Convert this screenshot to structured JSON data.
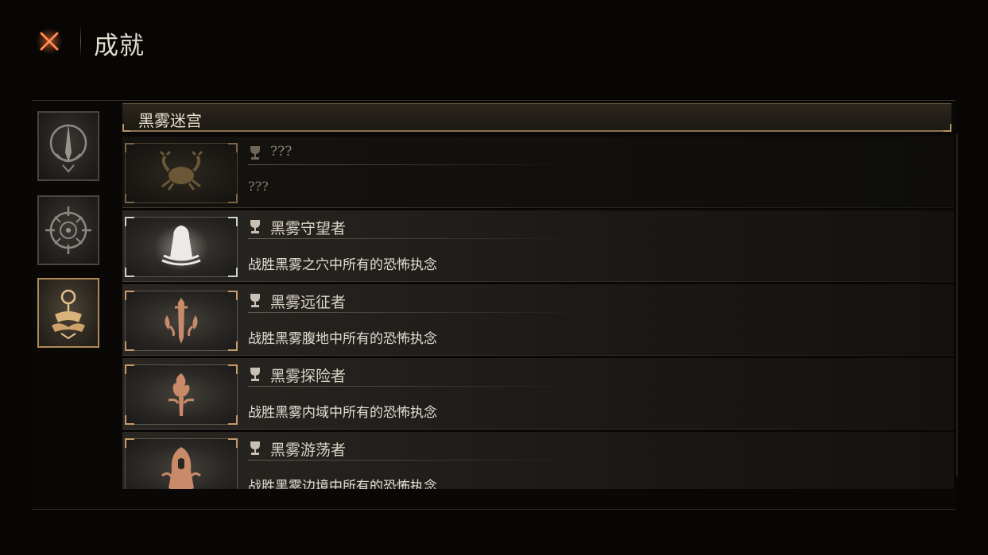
{
  "header": {
    "title": "成就",
    "close_icon": "close-x-icon",
    "accent_color": "#e0622c"
  },
  "categories": [
    {
      "icon": "lantern-spire-icon",
      "active": false
    },
    {
      "icon": "compass-wheel-icon",
      "active": false
    },
    {
      "icon": "ritual-figure-icon",
      "active": true
    }
  ],
  "section": {
    "title": "黑雾迷宫"
  },
  "achievements": [
    {
      "title": "???",
      "description": "???",
      "icon": "crab-emblem-icon",
      "unlocked": false
    },
    {
      "title": "黑雾守望者",
      "description": "战胜黑雾之穴中所有的恐怖执念",
      "icon": "hooded-ghost-icon",
      "unlocked": true
    },
    {
      "title": "黑雾远征者",
      "description": "战胜黑雾腹地中所有的恐怖执念",
      "icon": "sword-tendrils-icon",
      "unlocked": true
    },
    {
      "title": "黑雾探险者",
      "description": "战胜黑雾内域中所有的恐怖执念",
      "icon": "torch-flame-icon",
      "unlocked": true
    },
    {
      "title": "黑雾游荡者",
      "description": "战胜黑雾边境中所有的恐怖执念",
      "icon": "hooded-wanderer-icon",
      "unlocked": true
    }
  ],
  "colors": {
    "gold_border": "#b08a57",
    "copper_corner": "#c89a6a",
    "text_light": "#e3ddd2",
    "text_locked": "#8b8373"
  }
}
